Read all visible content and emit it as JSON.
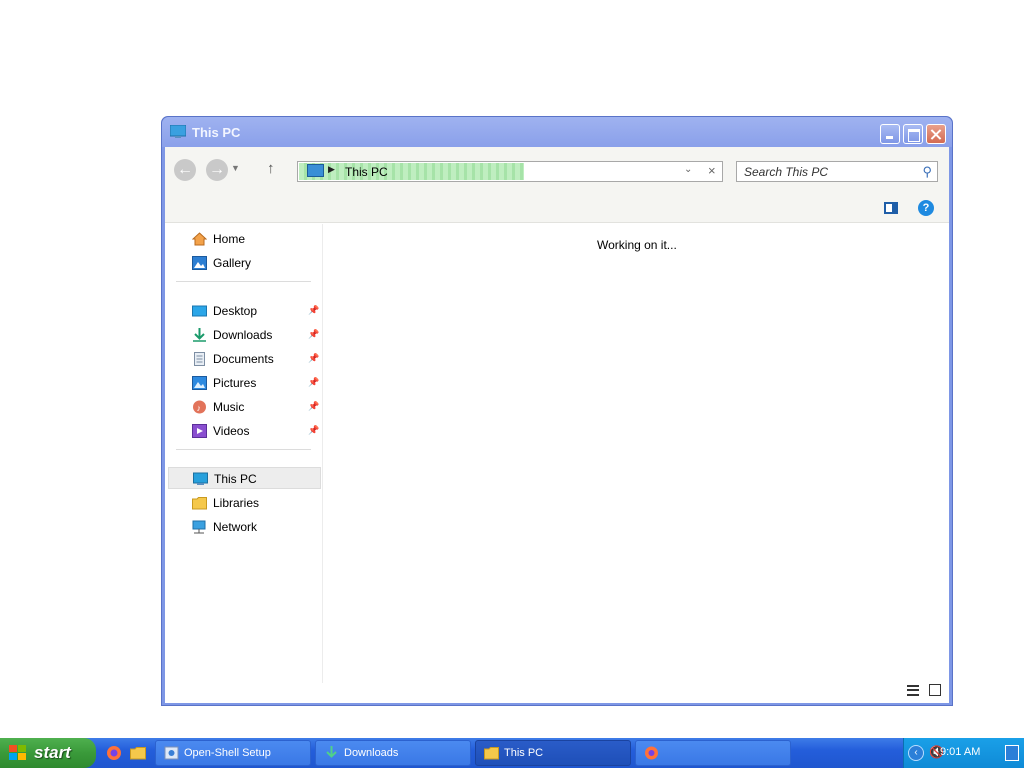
{
  "window": {
    "title": "This PC",
    "controls": {
      "minimize": "minimize",
      "maximize": "maximize",
      "close": "close"
    }
  },
  "navbar": {
    "back_icon": "arrow-left-icon",
    "forward_icon": "arrow-right-icon",
    "up_icon": "arrow-up-icon",
    "address": {
      "location": "This PC",
      "loading_progress": 0.53
    },
    "search": {
      "placeholder": "Search This PC"
    }
  },
  "ribbon": {
    "preview_pane_icon": "preview-pane-icon",
    "help_icon": "help-icon",
    "help_label": "?"
  },
  "sidebar": {
    "quick": [
      {
        "label": "Home",
        "icon": "home-icon"
      },
      {
        "label": "Gallery",
        "icon": "gallery-icon"
      }
    ],
    "pinned": [
      {
        "label": "Desktop",
        "icon": "desktop-icon"
      },
      {
        "label": "Downloads",
        "icon": "download-icon"
      },
      {
        "label": "Documents",
        "icon": "document-icon"
      },
      {
        "label": "Pictures",
        "icon": "pictures-icon"
      },
      {
        "label": "Music",
        "icon": "music-icon"
      },
      {
        "label": "Videos",
        "icon": "videos-icon"
      }
    ],
    "locations": [
      {
        "label": "This PC",
        "icon": "computer-icon",
        "selected": true
      },
      {
        "label": "Libraries",
        "icon": "folder-icon"
      },
      {
        "label": "Network",
        "icon": "network-icon"
      }
    ]
  },
  "content": {
    "status": "Working on it..."
  },
  "taskbar": {
    "start_label": "start",
    "quick_launch": [
      "firefox-icon",
      "folder-icon"
    ],
    "buttons": [
      {
        "label": "Open-Shell Setup",
        "icon": "setup-icon"
      },
      {
        "label": "Downloads",
        "icon": "download-icon"
      },
      {
        "label": "This PC",
        "icon": "folder-icon",
        "active": true
      },
      {
        "label": "",
        "icon": "firefox-icon"
      }
    ],
    "tray": {
      "time": "9:01 AM",
      "volume_icon": "volume-muted-icon",
      "network_icon": "network-icon"
    }
  },
  "colors": {
    "titlebar": "#8aa0ea",
    "taskbar": "#245edb",
    "start": "#3a9a3a",
    "progress": "#a6e3a8",
    "help": "#1f8ae0"
  }
}
